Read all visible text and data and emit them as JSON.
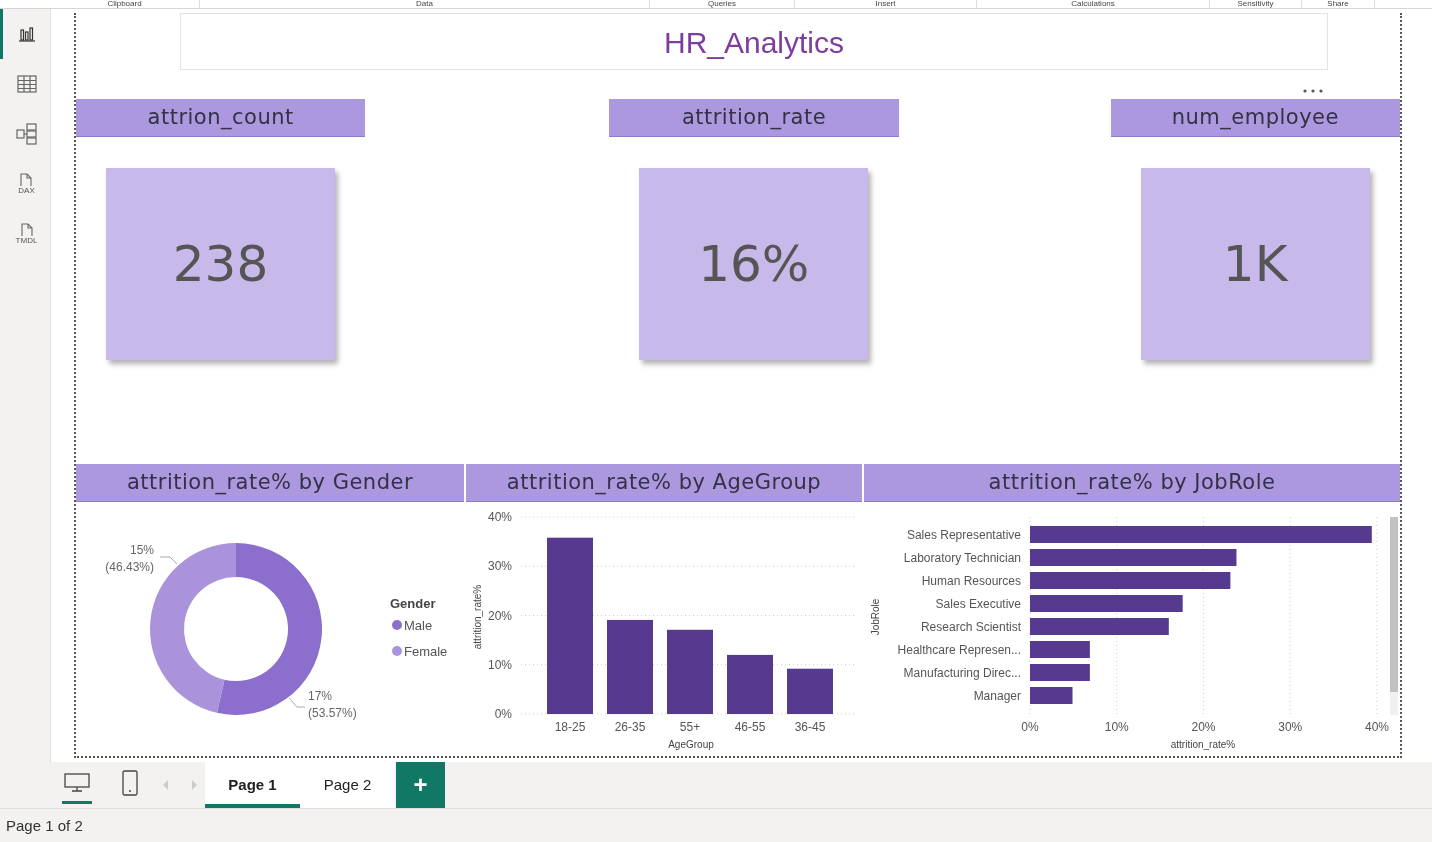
{
  "ribbon_groups": [
    "Clipboard",
    "Data",
    "Queries",
    "Insert",
    "Calculations",
    "Sensitivity",
    "Share"
  ],
  "sidebar": {
    "items": [
      {
        "kind": "report",
        "selected": true
      },
      {
        "kind": "table",
        "selected": false
      },
      {
        "kind": "model",
        "selected": false
      },
      {
        "kind": "dax",
        "label": "DAX",
        "selected": false
      },
      {
        "kind": "tmdl",
        "label": "TMDL",
        "selected": false
      }
    ]
  },
  "report": {
    "title": "HR_Analytics",
    "kpis": [
      {
        "header": "attrion_count",
        "value": "238"
      },
      {
        "header": "attrition_rate",
        "value": "16%"
      },
      {
        "header": "num_employee",
        "value": "1K"
      }
    ],
    "gender_chart": {
      "header": "attrition_rate% by Gender",
      "chart_data": {
        "type": "donut",
        "categories": [
          "Male",
          "Female"
        ],
        "colors": [
          "#8c6fcc",
          "#aa93da"
        ],
        "values": [
          0.1701,
          0.1475
        ],
        "value_labels": [
          "17% (53.57%)",
          "15% (46.43%)"
        ],
        "legend": {
          "title": "Gender"
        }
      }
    },
    "age_chart": {
      "header": "attrition_rate% by AgeGroup",
      "chart_data": {
        "type": "bar",
        "xlabel": "AgeGroup",
        "ylabel": "attrition_rate%",
        "categories": [
          "18-25",
          "26-35",
          "55+",
          "46-55",
          "36-45"
        ],
        "grid": true,
        "series": [
          {
            "color": "#553a8f",
            "values": [
              35.8,
              19.1,
              17.1,
              12.0,
              9.2
            ]
          }
        ],
        "ylim": [
          0,
          40
        ],
        "yticks": [
          {
            "value": 0,
            "label": "0%"
          },
          {
            "value": 10,
            "label": "10%"
          },
          {
            "value": 20,
            "label": "20%"
          },
          {
            "value": 30,
            "label": "30%"
          },
          {
            "value": 40,
            "label": "40%"
          }
        ]
      }
    },
    "job_chart": {
      "header": "attrition_rate% by JobRole",
      "chart_data": {
        "type": "bar",
        "orientation": "horizontal",
        "xlabel": "attrition_rate%",
        "ylabel": "JobRole",
        "categories": [
          "Sales Representative",
          "Laboratory Technician",
          "Human Resources",
          "Sales Executive",
          "Research Scientist",
          "Healthcare Represen...",
          "Manufacturing Direc...",
          "Manager"
        ],
        "grid": true,
        "series": [
          {
            "color": "#553a8f",
            "values": [
              39.4,
              23.8,
              23.1,
              17.6,
              16.0,
              6.9,
              6.9,
              4.9
            ]
          }
        ],
        "xlim": [
          0,
          40
        ],
        "xticks": [
          {
            "value": 0,
            "label": "0%"
          },
          {
            "value": 10,
            "label": "10%"
          },
          {
            "value": 20,
            "label": "20%"
          },
          {
            "value": 30,
            "label": "30%"
          },
          {
            "value": 40,
            "label": "40%"
          }
        ]
      }
    }
  },
  "views": [
    {
      "kind": "desktop",
      "selected": true
    },
    {
      "kind": "mobile",
      "selected": false
    }
  ],
  "page_tabs": [
    {
      "label": "Page 1",
      "selected": true
    },
    {
      "label": "Page 2",
      "selected": false
    }
  ],
  "add_page": "+",
  "status_bar": "Page 1 of 2"
}
